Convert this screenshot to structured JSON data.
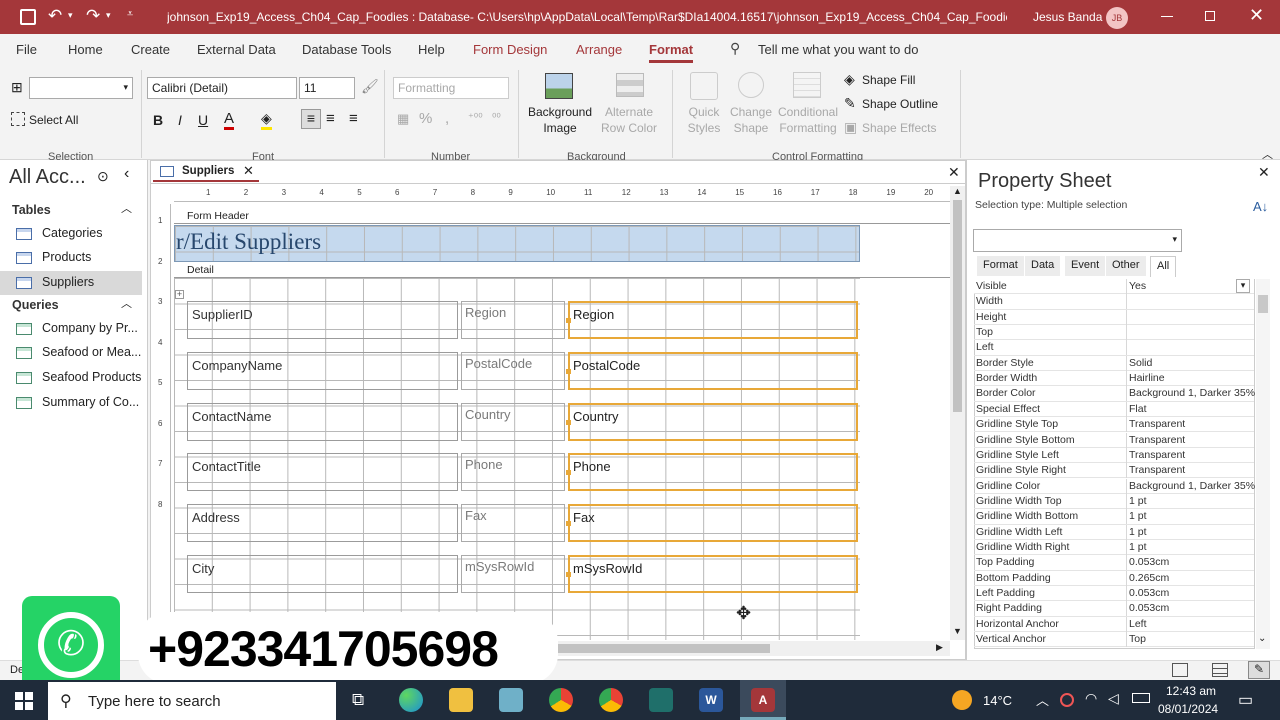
{
  "window": {
    "title": "johnson_Exp19_Access_Ch04_Cap_Foodies : Database- C:\\Users\\hp\\AppData\\Local\\Temp\\Rar$DIa14004.16517\\johnson_Exp19_Access_Ch04_Cap_Foodies.a...",
    "user": "Jesus Banda",
    "initials": "JB"
  },
  "menu": {
    "file": "File",
    "home": "Home",
    "create": "Create",
    "external": "External Data",
    "dbtools": "Database Tools",
    "help": "Help",
    "formdesign": "Form Design",
    "arrange": "Arrange",
    "format": "Format",
    "tellme": "Tell me what you want to do"
  },
  "ribbon": {
    "select_all": "Select All",
    "selection": "Selection",
    "font_name": "Calibri (Detail)",
    "font_size": "11",
    "font": "Font",
    "formatting": "Formatting",
    "number": "Number",
    "bg_image": "Background Image",
    "alt_row": "Alternate Row Color",
    "background": "Background",
    "quick_styles": "Quick Styles",
    "change_shape": "Change Shape",
    "cond_fmt": "Conditional Formatting",
    "shape_fill": "Shape Fill",
    "shape_outline": "Shape Outline",
    "shape_effects": "Shape Effects",
    "control_formatting": "Control Formatting",
    "bold": "B",
    "italic": "I",
    "underline": "U",
    "font_color_letter": "A"
  },
  "nav": {
    "title": "All Acc...",
    "tables_hdr": "Tables",
    "tables": [
      "Categories",
      "Products",
      "Suppliers"
    ],
    "queries_hdr": "Queries",
    "queries": [
      "Company by Pr...",
      "Seafood or Mea...",
      "Seafood Products",
      "Summary of Co..."
    ]
  },
  "doc": {
    "tab": "Suppliers",
    "form_header": "Form Header",
    "header_title": "r/Edit Suppliers",
    "detail": "Detail",
    "ruler_nums": [
      "1",
      "2",
      "3",
      "4",
      "5",
      "6",
      "7",
      "8",
      "9",
      "10",
      "11",
      "12",
      "13",
      "14",
      "15",
      "16",
      "17",
      "18",
      "19",
      "20",
      "21",
      "22",
      "23"
    ],
    "vruler_nums": [
      "1",
      "2",
      "3",
      "4",
      "5",
      "6",
      "7",
      "8"
    ],
    "left_boxes": [
      "SupplierID",
      "CompanyName",
      "ContactName",
      "ContactTitle",
      "Address",
      "City"
    ],
    "mid_labels": [
      "Region",
      "PostalCode",
      "Country",
      "Phone",
      "Fax",
      "mSysRowId"
    ],
    "right_boxes": [
      "Region",
      "PostalCode",
      "Country",
      "Phone",
      "Fax",
      "mSysRowId"
    ]
  },
  "property_sheet": {
    "title": "Property Sheet",
    "selection_type": "Selection type:  Multiple selection",
    "tabs": [
      "Format",
      "Data",
      "Event",
      "Other",
      "All"
    ],
    "active_tab": "All",
    "rows": [
      [
        "Visible",
        "Yes"
      ],
      [
        "Width",
        ""
      ],
      [
        "Height",
        ""
      ],
      [
        "Top",
        ""
      ],
      [
        "Left",
        ""
      ],
      [
        "Border Style",
        "Solid"
      ],
      [
        "Border Width",
        "Hairline"
      ],
      [
        "Border Color",
        "Background 1, Darker 35%"
      ],
      [
        "Special Effect",
        "Flat"
      ],
      [
        "Gridline Style Top",
        "Transparent"
      ],
      [
        "Gridline Style Bottom",
        "Transparent"
      ],
      [
        "Gridline Style Left",
        "Transparent"
      ],
      [
        "Gridline Style Right",
        "Transparent"
      ],
      [
        "Gridline Color",
        "Background 1, Darker 35%"
      ],
      [
        "Gridline Width Top",
        "1 pt"
      ],
      [
        "Gridline Width Bottom",
        "1 pt"
      ],
      [
        "Gridline Width Left",
        "1 pt"
      ],
      [
        "Gridline Width Right",
        "1 pt"
      ],
      [
        "Top Padding",
        "0.053cm"
      ],
      [
        "Bottom Padding",
        "0.265cm"
      ],
      [
        "Left Padding",
        "0.053cm"
      ],
      [
        "Right Padding",
        "0.053cm"
      ],
      [
        "Horizontal Anchor",
        "Left"
      ],
      [
        "Vertical Anchor",
        "Top"
      ]
    ]
  },
  "status": {
    "left": "De"
  },
  "overlay": {
    "phone": "+923341705698"
  },
  "taskbar": {
    "search": "Type here to search",
    "temp": "14°C",
    "time": "12:43 am",
    "date": "08/01/2024"
  },
  "colors": {
    "title_bar": "#a4373a",
    "accent": "#a4373a",
    "selection": "#e8a838",
    "header_band": "#c5d9ee",
    "whatsapp": "#25d366",
    "taskbar": "#1f2b3a"
  }
}
